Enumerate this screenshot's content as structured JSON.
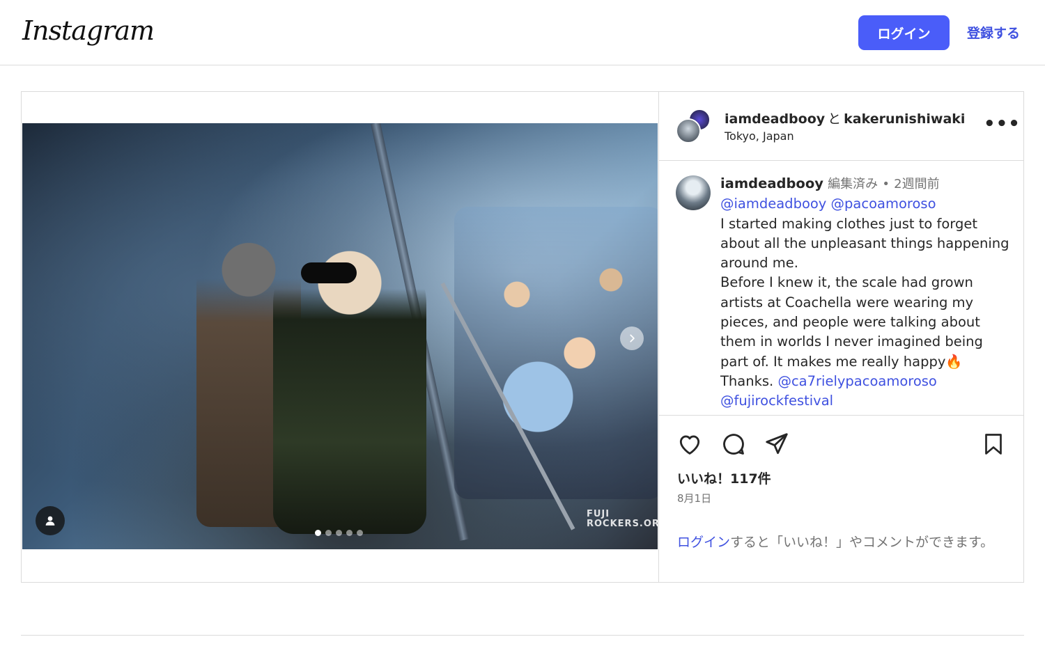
{
  "header": {
    "logo": "Instagram",
    "login_button": "ログイン",
    "signup_link": "登録する"
  },
  "post": {
    "author": "iamdeadbooy",
    "conjunction": "と",
    "collaborator": "kakerunishiwaki",
    "location": "Tokyo, Japan",
    "more_icon": "more-horizontal-icon",
    "media": {
      "watermark": "FUJI ROCKERS.ORG",
      "carousel_count": 5,
      "carousel_active_index": 0,
      "user_tag_icon": "user-tag-icon",
      "next_icon": "chevron-right-icon"
    },
    "caption": {
      "username": "iamdeadbooy",
      "edited": "編集済み",
      "separator": "•",
      "time": "2週間前",
      "mention1": "@iamdeadbooy",
      "mention2": "@pacoamoroso",
      "text": "I started making clothes just to forget about all the unpleasant things happening around me.\nBefore I knew it, the scale had grown artists at Coachella were wearing my pieces, and people were talking about them in worlds I never imagined being part of. It makes me really happy🔥\n",
      "thanks": "Thanks. ",
      "mention3": "@ca7rielypacoamoroso",
      "mention4": "@fujirockfestival"
    },
    "likes": "いいね！117件",
    "date": "8月1日",
    "login_prompt_link": "ログイン",
    "login_prompt_text": "すると「いいね！」やコメントができます。"
  },
  "icons": {
    "like": "heart-icon",
    "comment": "comment-icon",
    "share": "send-icon",
    "save": "bookmark-icon"
  }
}
